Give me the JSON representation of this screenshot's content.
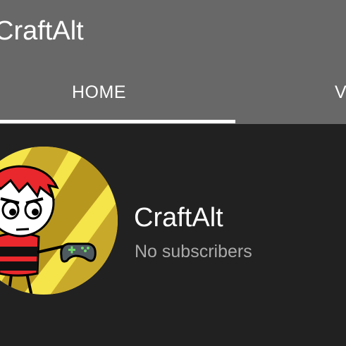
{
  "header": {
    "title": "CraftAlt",
    "background": "#686868"
  },
  "tabs": [
    {
      "label": "HOME",
      "selected": true
    },
    {
      "label": "VIDEOS",
      "selected": false
    }
  ],
  "channel": {
    "name": "CraftAlt",
    "subscribers": "No subscribers",
    "avatar_icon": "cartoon-gamer-avatar"
  },
  "colors": {
    "page_background": "#212121",
    "tab_indicator": "#ffffff",
    "avatar_yellow": "#f5e44a",
    "avatar_gold": "#c9a92a"
  }
}
